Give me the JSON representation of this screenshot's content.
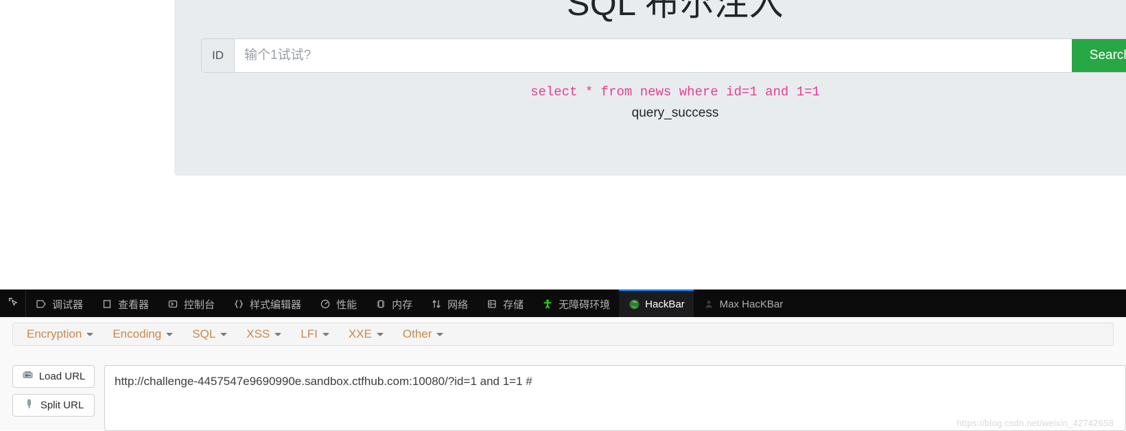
{
  "page": {
    "title": "SQL 布尔注入",
    "search": {
      "addon_label": "ID",
      "input_value": "",
      "placeholder": "输个1试试?",
      "button_label": "Search"
    },
    "result": {
      "sql_query": "select * from news where id=1 and 1=1",
      "status_text": "query_success",
      "sql_color": "#e83e8c",
      "button_color": "#28a745"
    }
  },
  "devtools": {
    "picker_icon": "element-picker-icon",
    "active_tab": "HackBar",
    "accent_color": "#0a84ff",
    "tabs": [
      {
        "label": "调试器",
        "icon": "debugger-icon",
        "active": false
      },
      {
        "label": "查看器",
        "icon": "inspector-icon",
        "active": false
      },
      {
        "label": "控制台",
        "icon": "console-icon",
        "active": false
      },
      {
        "label": "样式编辑器",
        "icon": "style-editor-icon",
        "active": false
      },
      {
        "label": "性能",
        "icon": "performance-icon",
        "active": false
      },
      {
        "label": "内存",
        "icon": "memory-icon",
        "active": false
      },
      {
        "label": "网络",
        "icon": "network-icon",
        "active": false
      },
      {
        "label": "存储",
        "icon": "storage-icon",
        "active": false
      },
      {
        "label": "无障碍环境",
        "icon": "accessibility-icon",
        "active": false
      },
      {
        "label": "HackBar",
        "icon": "hackbar-icon",
        "active": true
      },
      {
        "label": "Max HacKBar",
        "icon": "max-hackbar-icon",
        "active": false
      }
    ]
  },
  "hackbar": {
    "menu": [
      {
        "label": "Encryption"
      },
      {
        "label": "Encoding"
      },
      {
        "label": "SQL"
      },
      {
        "label": "XSS"
      },
      {
        "label": "LFI"
      },
      {
        "label": "XXE"
      },
      {
        "label": "Other"
      }
    ],
    "buttons": [
      {
        "label": "Load URL",
        "icon": "load-url-icon"
      },
      {
        "label": "Split URL",
        "icon": "split-url-icon"
      }
    ],
    "url_value": "http://challenge-4457547e9690990e.sandbox.ctfhub.com:10080/?id=1 and 1=1 #",
    "watermark": "https://blog.csdn.net/weixin_42742658"
  }
}
